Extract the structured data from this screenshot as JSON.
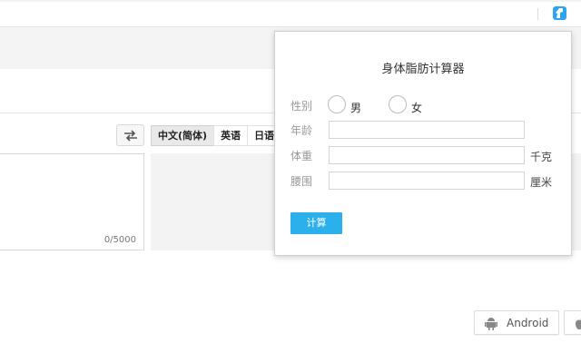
{
  "popup": {
    "title": "身体脂肪计算器",
    "gender_label": "性别",
    "gender_options": [
      "男",
      "女"
    ],
    "age_label": "年龄",
    "weight_label": "体重",
    "weight_unit": "千克",
    "waist_label": "腰围",
    "waist_unit": "厘米",
    "calculate_label": "计算",
    "accent_color": "#2bb0ec"
  },
  "translator": {
    "languages": [
      "中文(简体)",
      "英语",
      "日语"
    ],
    "active_language": "中文(简体)",
    "char_count": "0/5000"
  },
  "apps": {
    "android_label": "Android"
  },
  "icons": {
    "extension": "body-fat-calculator-extension-icon",
    "swap": "swap-arrows-icon",
    "android": "android-icon",
    "apple": "apple-icon"
  }
}
